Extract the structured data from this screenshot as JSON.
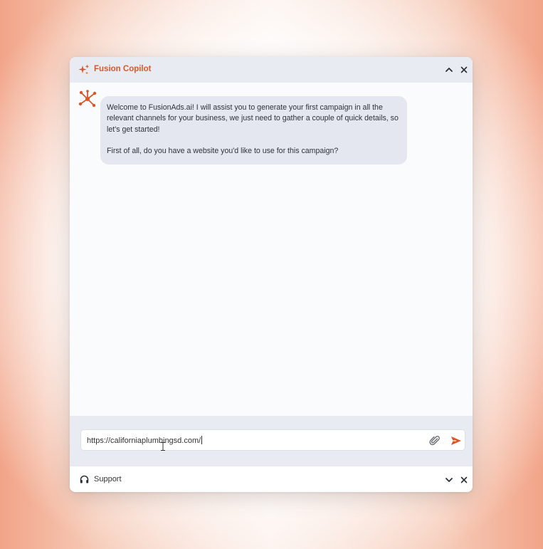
{
  "window": {
    "title": "Fusion Copilot",
    "accent_color": "#d9582a",
    "title_icon": "sparkles-icon",
    "buttons": [
      "chevron-up-icon",
      "close-icon"
    ]
  },
  "chat": {
    "bot_avatar_icon": "network-nodes-icon",
    "messages": [
      {
        "sender": "bot",
        "paragraphs": [
          "Welcome to FusionAds.ai! I will assist you to generate your first campaign in all the relevant channels for your business, we just need to gather a couple of quick details, so let's get started!",
          "First of all, do you have a website you'd like to use for this campaign?"
        ]
      }
    ]
  },
  "composer": {
    "input_value": "https://californiaplumbingsd.com/",
    "attach_icon": "paperclip-icon",
    "send_icon": "send-icon"
  },
  "footer": {
    "label": "Support",
    "icon": "headset-icon",
    "buttons": [
      "chevron-down-icon",
      "close-icon"
    ]
  }
}
